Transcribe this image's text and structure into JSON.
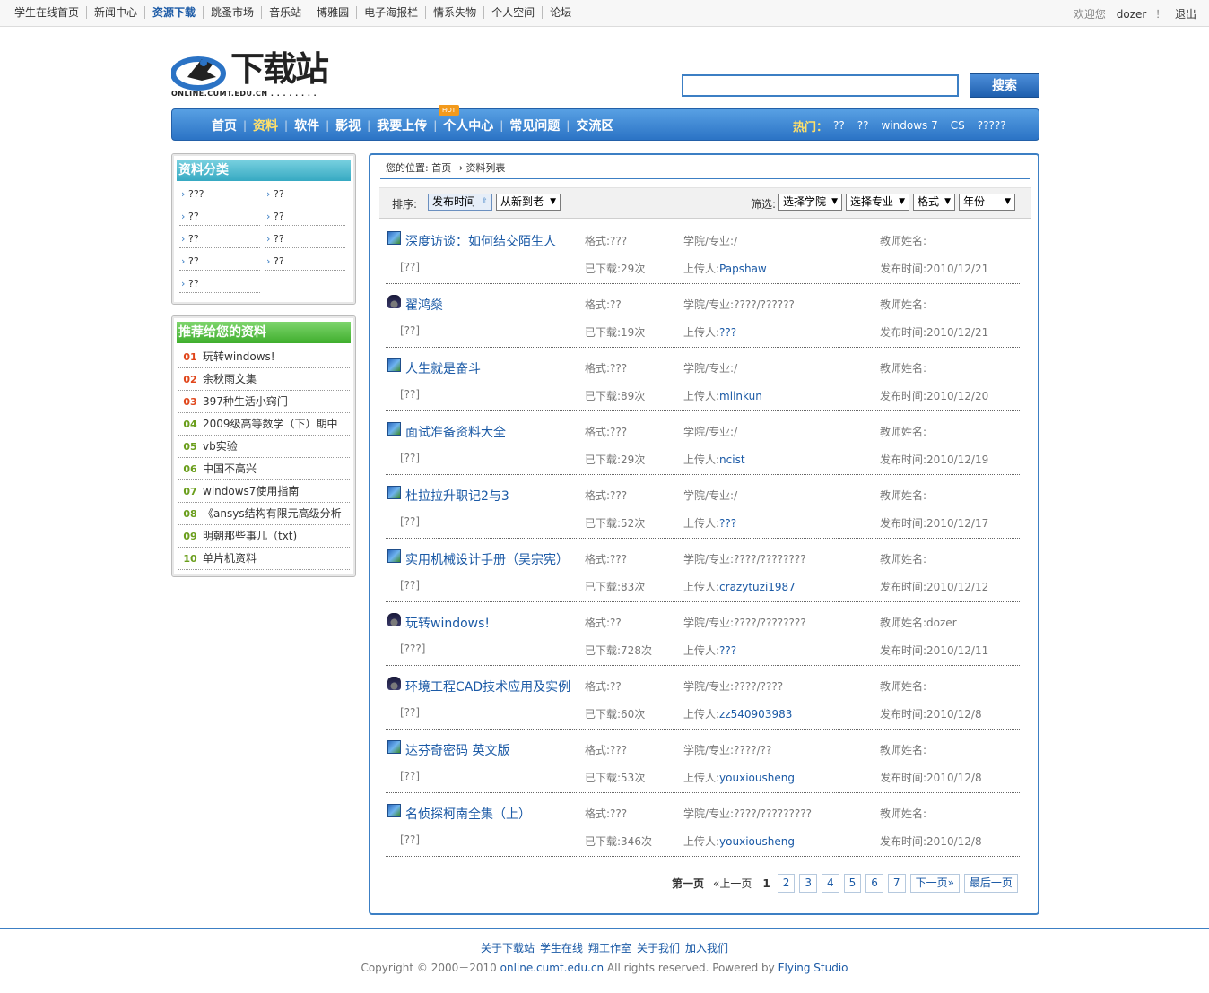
{
  "topbar": {
    "nav": [
      {
        "label": "学生在线首页",
        "active": false
      },
      {
        "label": "新闻中心",
        "active": false
      },
      {
        "label": "资源下载",
        "active": true
      },
      {
        "label": "跳蚤市场",
        "active": false
      },
      {
        "label": "音乐站",
        "active": false
      },
      {
        "label": "博雅园",
        "active": false
      },
      {
        "label": "电子海报栏",
        "active": false
      },
      {
        "label": "情系失物",
        "active": false
      },
      {
        "label": "个人空间",
        "active": false
      },
      {
        "label": "论坛",
        "active": false
      }
    ],
    "welcome": "欢迎您",
    "username": "dozer",
    "sep": "！",
    "logout": "退出"
  },
  "header": {
    "logo_cn": "下载站",
    "logo_en": "ONLINE.CUMT.EDU.CN . . . . . . . .",
    "search_placeholder": "",
    "search_button": "搜索"
  },
  "mainnav": {
    "items": [
      "首页",
      "资料",
      "软件",
      "影视",
      "我要上传",
      "个人中心",
      "常见问题",
      "交流区"
    ],
    "active_index": 1,
    "hot_badge": "HOT",
    "hot_label": "热门：",
    "hot_links": [
      "??",
      "??",
      "windows 7",
      "CS",
      "?????"
    ]
  },
  "sidebar": {
    "categories_title": "资料分类",
    "categories": [
      "???",
      "??",
      "??",
      "??",
      "??",
      "??",
      "??",
      "??",
      "??"
    ],
    "recommend_title": "推荐给您的资料",
    "recommend": [
      {
        "num": "01",
        "title": "玩转windows!"
      },
      {
        "num": "02",
        "title": "余秋雨文集"
      },
      {
        "num": "03",
        "title": "397种生活小窍门"
      },
      {
        "num": "04",
        "title": "2009级高等数学（下）期中"
      },
      {
        "num": "05",
        "title": "vb实验"
      },
      {
        "num": "06",
        "title": "中国不高兴"
      },
      {
        "num": "07",
        "title": "windows7使用指南"
      },
      {
        "num": "08",
        "title": "《ansys结构有限元高级分析"
      },
      {
        "num": "09",
        "title": "明朝那些事儿（txt)"
      },
      {
        "num": "10",
        "title": "单片机资料"
      }
    ]
  },
  "breadcrumb": {
    "prefix": "您的位置:",
    "home": "首页",
    "arrow": "→",
    "current": "资料列表"
  },
  "sortbar": {
    "sort_label": "排序:",
    "sort_field": "发布时间",
    "sort_order": "从新到老",
    "filter_label": "筛选:",
    "filters": [
      "选择学院",
      "选择专业",
      "格式",
      "年份"
    ]
  },
  "labels": {
    "format": "格式:",
    "college": "学院/专业:",
    "teacher": "教师姓名:",
    "downloaded": "已下载:",
    "uploader": "上传人:",
    "published": "发布时间:",
    "times": "次"
  },
  "files": [
    {
      "icon": "picture-icon",
      "title": "深度访谈：如何结交陌生人",
      "format": "???",
      "college": "/",
      "teacher": "",
      "tag": "[??]",
      "downloads": "29",
      "uploader": "Papshaw",
      "date": "2010/12/21"
    },
    {
      "icon": "graduation-cap-icon",
      "title": "翟鸿燊",
      "format": "??",
      "college": "????/??????",
      "teacher": "",
      "tag": "[??]",
      "downloads": "19",
      "uploader": "???",
      "date": "2010/12/21"
    },
    {
      "icon": "picture-icon",
      "title": "人生就是奋斗",
      "format": "???",
      "college": "/",
      "teacher": "",
      "tag": "[??]",
      "downloads": "89",
      "uploader": "mlinkun",
      "date": "2010/12/20"
    },
    {
      "icon": "picture-icon",
      "title": "面试准备资料大全",
      "format": "???",
      "college": "/",
      "teacher": "",
      "tag": "[??]",
      "downloads": "29",
      "uploader": "ncist",
      "date": "2010/12/19"
    },
    {
      "icon": "picture-icon",
      "title": "杜拉拉升职记2与3",
      "format": "???",
      "college": "/",
      "teacher": "",
      "tag": "[??]",
      "downloads": "52",
      "uploader": "???",
      "date": "2010/12/17"
    },
    {
      "icon": "picture-icon",
      "title": "实用机械设计手册（吴宗宪）",
      "format": "???",
      "college": "????/????????",
      "teacher": "",
      "tag": "[??]",
      "downloads": "83",
      "uploader": "crazytuzi1987",
      "date": "2010/12/12"
    },
    {
      "icon": "graduation-cap-icon",
      "title": "玩转windows!",
      "format": "??",
      "college": "????/????????",
      "teacher": "dozer",
      "tag": "[???]",
      "downloads": "728",
      "uploader": "???",
      "date": "2010/12/11"
    },
    {
      "icon": "graduation-cap-icon",
      "title": "环境工程CAD技术应用及实例",
      "format": "??",
      "college": "????/????",
      "teacher": "",
      "tag": "[??]",
      "downloads": "60",
      "uploader": "zz540903983",
      "date": "2010/12/8"
    },
    {
      "icon": "picture-icon",
      "title": "达芬奇密码 英文版",
      "format": "???",
      "college": "????/??",
      "teacher": "",
      "tag": "[??]",
      "downloads": "53",
      "uploader": "youxiousheng",
      "date": "2010/12/8"
    },
    {
      "icon": "picture-icon",
      "title": "名侦探柯南全集（上）",
      "format": "???",
      "college": "????/?????????",
      "teacher": "",
      "tag": "[??]",
      "downloads": "346",
      "uploader": "youxiousheng",
      "date": "2010/12/8"
    }
  ],
  "pagination": {
    "first": "第一页",
    "prev": "«上一页",
    "current": "1",
    "pages": [
      "2",
      "3",
      "4",
      "5",
      "6",
      "7"
    ],
    "next": "下一页»",
    "last": "最后一页"
  },
  "footer": {
    "links": [
      "关于下载站",
      "学生在线",
      "翔工作室",
      "关于我们",
      "加入我们"
    ],
    "copyright": "Copyright © 2000－2010",
    "site": "online.cumt.edu.cn",
    "rights": "All rights reserved. Powered by",
    "studio": "Flying Studio"
  },
  "colors": {
    "accent": "#3c7fc4",
    "link": "#1b5aa6",
    "nav_active": "#ffe06b",
    "category_header": "#36a9c2",
    "recommend_header": "#3fae2d",
    "rank_top": "#e0461b",
    "rank_other": "#6a9e1c"
  }
}
